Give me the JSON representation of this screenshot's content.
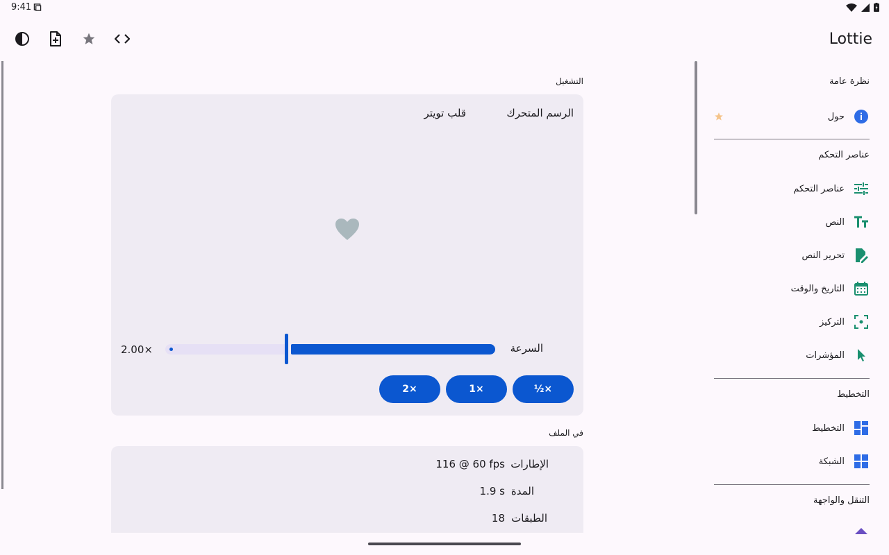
{
  "status": {
    "time": "9:41"
  },
  "app": {
    "title": "Lottie"
  },
  "toolbar": {
    "theme_icon": "contrast-icon",
    "new_doc_icon": "note-add-icon",
    "favorite_icon": "star-icon",
    "code_icon": "code-icon"
  },
  "playback": {
    "section_label": "التشغيل",
    "animation_label": "الرسم المتحرك",
    "animation_value": "قلب تويتر",
    "speed_label": "السرعة",
    "speed_value": "2.00×",
    "speed_fraction": 0.5,
    "buttons": [
      "½×",
      "1×",
      "2×"
    ]
  },
  "file": {
    "section_label": "في الملف",
    "rows": [
      {
        "label": "الإطارات",
        "value": "116 @ 60 fps"
      },
      {
        "label": "المدة",
        "value": "1.9 s"
      },
      {
        "label": "الطبقات",
        "value": "18"
      }
    ]
  },
  "nav": {
    "overview_header": "نظرة عامة",
    "about": "حول",
    "controls_header": "عناصر التحكم",
    "controls": "عناصر التحكم",
    "text": "النص",
    "edit_text": "تحرير النص",
    "date_time": "التاريخ والوقت",
    "focus": "التركيز",
    "pointers": "المؤشرات",
    "layout_header": "التخطيط",
    "layout": "التخطيط",
    "grid": "الشبكة",
    "navigation_header": "التنقل والواجهة"
  },
  "colors": {
    "accent": "#0b57d0",
    "teal_icon": "#1a8f6f",
    "track": "#e6e0f5",
    "card": "#efebf3"
  }
}
